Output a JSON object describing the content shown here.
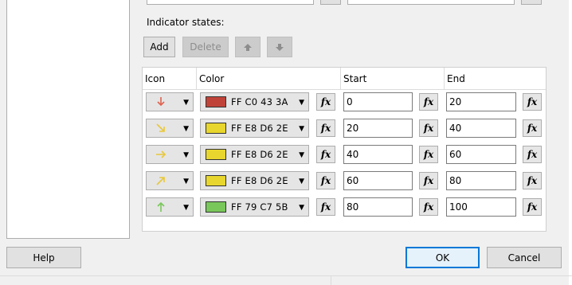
{
  "indicator_states": {
    "title": "Indicator states:",
    "add_label": "Add",
    "delete_label": "Delete"
  },
  "grid": {
    "headers": {
      "icon": "Icon",
      "color": "Color",
      "start": "Start",
      "end": "End"
    },
    "rows": [
      {
        "icon": "arrow-down-icon",
        "icon_color": "#e0624f",
        "color_text": "FF C0 43 3A",
        "swatch": "#c0433a",
        "start": "0",
        "end": "20"
      },
      {
        "icon": "arrow-down-right-icon",
        "icon_color": "#e8c83a",
        "color_text": "FF E8 D6 2E",
        "swatch": "#e8d62e",
        "start": "20",
        "end": "40"
      },
      {
        "icon": "arrow-right-icon",
        "icon_color": "#e8c83a",
        "color_text": "FF E8 D6 2E",
        "swatch": "#e8d62e",
        "start": "40",
        "end": "60"
      },
      {
        "icon": "arrow-up-right-icon",
        "icon_color": "#e8c83a",
        "color_text": "FF E8 D6 2E",
        "swatch": "#e8d62e",
        "start": "60",
        "end": "80"
      },
      {
        "icon": "arrow-up-icon",
        "icon_color": "#79c75b",
        "color_text": "FF 79 C7 5B",
        "swatch": "#79c75b",
        "start": "80",
        "end": "100"
      }
    ],
    "fx_label": "fx"
  },
  "footer": {
    "help_label": "Help",
    "ok_label": "OK",
    "cancel_label": "Cancel"
  }
}
